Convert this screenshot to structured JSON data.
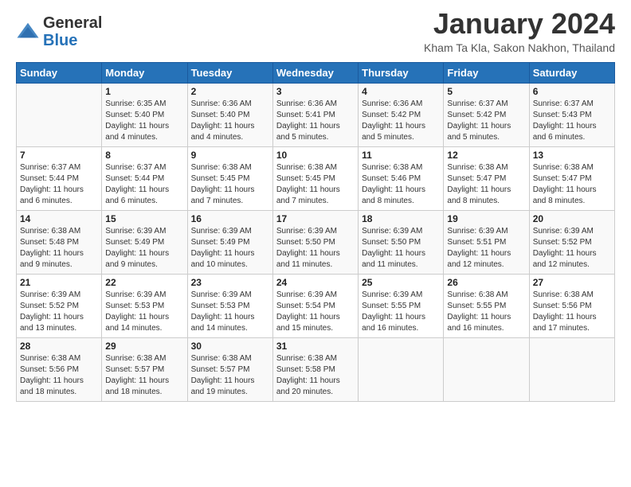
{
  "header": {
    "logo_general": "General",
    "logo_blue": "Blue",
    "month_title": "January 2024",
    "subtitle": "Kham Ta Kla, Sakon Nakhon, Thailand"
  },
  "weekdays": [
    "Sunday",
    "Monday",
    "Tuesday",
    "Wednesday",
    "Thursday",
    "Friday",
    "Saturday"
  ],
  "weeks": [
    [
      {
        "day": "",
        "sunrise": "",
        "sunset": "",
        "daylight": ""
      },
      {
        "day": "1",
        "sunrise": "Sunrise: 6:35 AM",
        "sunset": "Sunset: 5:40 PM",
        "daylight": "Daylight: 11 hours and 4 minutes."
      },
      {
        "day": "2",
        "sunrise": "Sunrise: 6:36 AM",
        "sunset": "Sunset: 5:40 PM",
        "daylight": "Daylight: 11 hours and 4 minutes."
      },
      {
        "day": "3",
        "sunrise": "Sunrise: 6:36 AM",
        "sunset": "Sunset: 5:41 PM",
        "daylight": "Daylight: 11 hours and 5 minutes."
      },
      {
        "day": "4",
        "sunrise": "Sunrise: 6:36 AM",
        "sunset": "Sunset: 5:42 PM",
        "daylight": "Daylight: 11 hours and 5 minutes."
      },
      {
        "day": "5",
        "sunrise": "Sunrise: 6:37 AM",
        "sunset": "Sunset: 5:42 PM",
        "daylight": "Daylight: 11 hours and 5 minutes."
      },
      {
        "day": "6",
        "sunrise": "Sunrise: 6:37 AM",
        "sunset": "Sunset: 5:43 PM",
        "daylight": "Daylight: 11 hours and 6 minutes."
      }
    ],
    [
      {
        "day": "7",
        "sunrise": "Sunrise: 6:37 AM",
        "sunset": "Sunset: 5:44 PM",
        "daylight": "Daylight: 11 hours and 6 minutes."
      },
      {
        "day": "8",
        "sunrise": "Sunrise: 6:37 AM",
        "sunset": "Sunset: 5:44 PM",
        "daylight": "Daylight: 11 hours and 6 minutes."
      },
      {
        "day": "9",
        "sunrise": "Sunrise: 6:38 AM",
        "sunset": "Sunset: 5:45 PM",
        "daylight": "Daylight: 11 hours and 7 minutes."
      },
      {
        "day": "10",
        "sunrise": "Sunrise: 6:38 AM",
        "sunset": "Sunset: 5:45 PM",
        "daylight": "Daylight: 11 hours and 7 minutes."
      },
      {
        "day": "11",
        "sunrise": "Sunrise: 6:38 AM",
        "sunset": "Sunset: 5:46 PM",
        "daylight": "Daylight: 11 hours and 8 minutes."
      },
      {
        "day": "12",
        "sunrise": "Sunrise: 6:38 AM",
        "sunset": "Sunset: 5:47 PM",
        "daylight": "Daylight: 11 hours and 8 minutes."
      },
      {
        "day": "13",
        "sunrise": "Sunrise: 6:38 AM",
        "sunset": "Sunset: 5:47 PM",
        "daylight": "Daylight: 11 hours and 8 minutes."
      }
    ],
    [
      {
        "day": "14",
        "sunrise": "Sunrise: 6:38 AM",
        "sunset": "Sunset: 5:48 PM",
        "daylight": "Daylight: 11 hours and 9 minutes."
      },
      {
        "day": "15",
        "sunrise": "Sunrise: 6:39 AM",
        "sunset": "Sunset: 5:49 PM",
        "daylight": "Daylight: 11 hours and 9 minutes."
      },
      {
        "day": "16",
        "sunrise": "Sunrise: 6:39 AM",
        "sunset": "Sunset: 5:49 PM",
        "daylight": "Daylight: 11 hours and 10 minutes."
      },
      {
        "day": "17",
        "sunrise": "Sunrise: 6:39 AM",
        "sunset": "Sunset: 5:50 PM",
        "daylight": "Daylight: 11 hours and 11 minutes."
      },
      {
        "day": "18",
        "sunrise": "Sunrise: 6:39 AM",
        "sunset": "Sunset: 5:50 PM",
        "daylight": "Daylight: 11 hours and 11 minutes."
      },
      {
        "day": "19",
        "sunrise": "Sunrise: 6:39 AM",
        "sunset": "Sunset: 5:51 PM",
        "daylight": "Daylight: 11 hours and 12 minutes."
      },
      {
        "day": "20",
        "sunrise": "Sunrise: 6:39 AM",
        "sunset": "Sunset: 5:52 PM",
        "daylight": "Daylight: 11 hours and 12 minutes."
      }
    ],
    [
      {
        "day": "21",
        "sunrise": "Sunrise: 6:39 AM",
        "sunset": "Sunset: 5:52 PM",
        "daylight": "Daylight: 11 hours and 13 minutes."
      },
      {
        "day": "22",
        "sunrise": "Sunrise: 6:39 AM",
        "sunset": "Sunset: 5:53 PM",
        "daylight": "Daylight: 11 hours and 14 minutes."
      },
      {
        "day": "23",
        "sunrise": "Sunrise: 6:39 AM",
        "sunset": "Sunset: 5:53 PM",
        "daylight": "Daylight: 11 hours and 14 minutes."
      },
      {
        "day": "24",
        "sunrise": "Sunrise: 6:39 AM",
        "sunset": "Sunset: 5:54 PM",
        "daylight": "Daylight: 11 hours and 15 minutes."
      },
      {
        "day": "25",
        "sunrise": "Sunrise: 6:39 AM",
        "sunset": "Sunset: 5:55 PM",
        "daylight": "Daylight: 11 hours and 16 minutes."
      },
      {
        "day": "26",
        "sunrise": "Sunrise: 6:38 AM",
        "sunset": "Sunset: 5:55 PM",
        "daylight": "Daylight: 11 hours and 16 minutes."
      },
      {
        "day": "27",
        "sunrise": "Sunrise: 6:38 AM",
        "sunset": "Sunset: 5:56 PM",
        "daylight": "Daylight: 11 hours and 17 minutes."
      }
    ],
    [
      {
        "day": "28",
        "sunrise": "Sunrise: 6:38 AM",
        "sunset": "Sunset: 5:56 PM",
        "daylight": "Daylight: 11 hours and 18 minutes."
      },
      {
        "day": "29",
        "sunrise": "Sunrise: 6:38 AM",
        "sunset": "Sunset: 5:57 PM",
        "daylight": "Daylight: 11 hours and 18 minutes."
      },
      {
        "day": "30",
        "sunrise": "Sunrise: 6:38 AM",
        "sunset": "Sunset: 5:57 PM",
        "daylight": "Daylight: 11 hours and 19 minutes."
      },
      {
        "day": "31",
        "sunrise": "Sunrise: 6:38 AM",
        "sunset": "Sunset: 5:58 PM",
        "daylight": "Daylight: 11 hours and 20 minutes."
      },
      {
        "day": "",
        "sunrise": "",
        "sunset": "",
        "daylight": ""
      },
      {
        "day": "",
        "sunrise": "",
        "sunset": "",
        "daylight": ""
      },
      {
        "day": "",
        "sunrise": "",
        "sunset": "",
        "daylight": ""
      }
    ]
  ]
}
